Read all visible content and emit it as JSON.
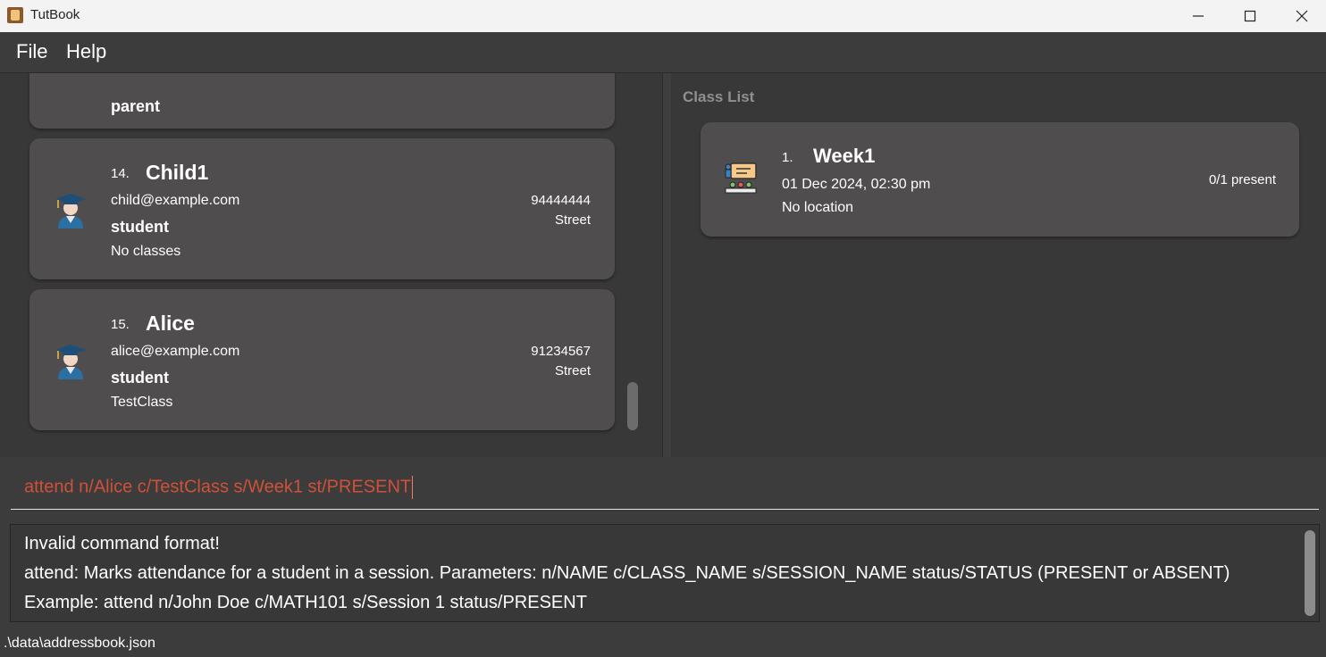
{
  "window": {
    "title": "TutBook"
  },
  "menu": {
    "file": "File",
    "help": "Help"
  },
  "persons": {
    "partial": {
      "role": "parent"
    },
    "cards": [
      {
        "index": "14.",
        "name": "Child1",
        "email": "child@example.com",
        "role": "student",
        "classes": "No classes",
        "phone": "94444444",
        "address": "Street"
      },
      {
        "index": "15.",
        "name": "Alice",
        "email": "alice@example.com",
        "role": "student",
        "classes": "TestClass",
        "phone": "91234567",
        "address": "Street"
      }
    ]
  },
  "class_panel": {
    "title": "Class List",
    "sessions": [
      {
        "index": "1.",
        "name": "Week1",
        "datetime": "01 Dec 2024, 02:30 pm",
        "location": "No location",
        "attendance": "0/1 present"
      }
    ]
  },
  "command": {
    "value": "attend n/Alice c/TestClass s/Week1 st/PRESENT"
  },
  "result": {
    "lines": [
      "Invalid command format!",
      "attend: Marks attendance for a student in a session. Parameters: n/NAME c/CLASS_NAME s/SESSION_NAME status/STATUS (PRESENT or ABSENT)",
      "Example: attend n/John Doe c/MATH101 s/Session 1 status/PRESENT"
    ]
  },
  "status": {
    "path": ".\\data\\addressbook.json"
  },
  "icons": {
    "app": "app-icon",
    "student": "student-avatar-icon",
    "session": "classroom-icon"
  },
  "colors": {
    "command_text": "#d0503a",
    "card_bg": "#4f4d4e"
  }
}
